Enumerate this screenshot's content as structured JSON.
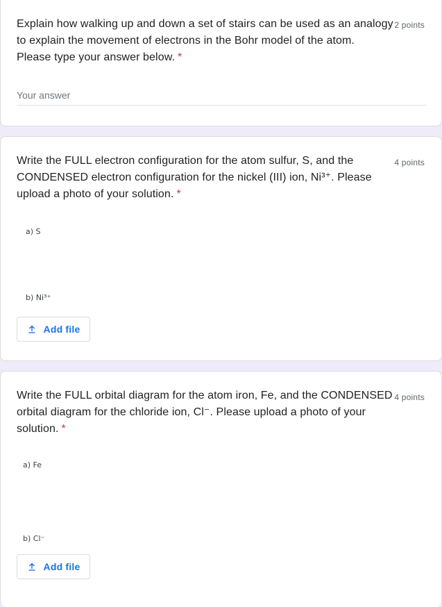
{
  "questions": [
    {
      "lines": [
        "Explain how walking up and down a set of stairs can be used as an analogy",
        "to explain the movement of electrons in the Bohr model of the atom.",
        "Please type your answer below."
      ],
      "required_mark": "*",
      "points": "2 points",
      "answer_placeholder": "Your answer"
    },
    {
      "lines": [
        "Write the FULL electron configuration for the atom sulfur, S, and the",
        "CONDENSED electron configuration for the nickel (III) ion, Ni³⁺. Please",
        "upload a photo of your solution."
      ],
      "required_mark": "*",
      "points": "4 points",
      "image_labels": [
        "a) S",
        "b) Ni³⁺"
      ],
      "add_file_label": "Add file"
    },
    {
      "lines": [
        "Write the FULL orbital diagram for the atom iron, Fe, and the CONDENSED",
        "orbital diagram for the chloride ion, Cl⁻. Please upload a photo of your",
        "solution."
      ],
      "required_mark": "*",
      "points": "4 points",
      "image_labels": [
        "a) Fe",
        "b) Cl⁻"
      ],
      "add_file_label": "Add file"
    }
  ],
  "icons": {
    "add_file": "upload-icon"
  },
  "colors": {
    "accent": "#1a73e8",
    "required": "#d93025",
    "background": "#efebf8"
  }
}
